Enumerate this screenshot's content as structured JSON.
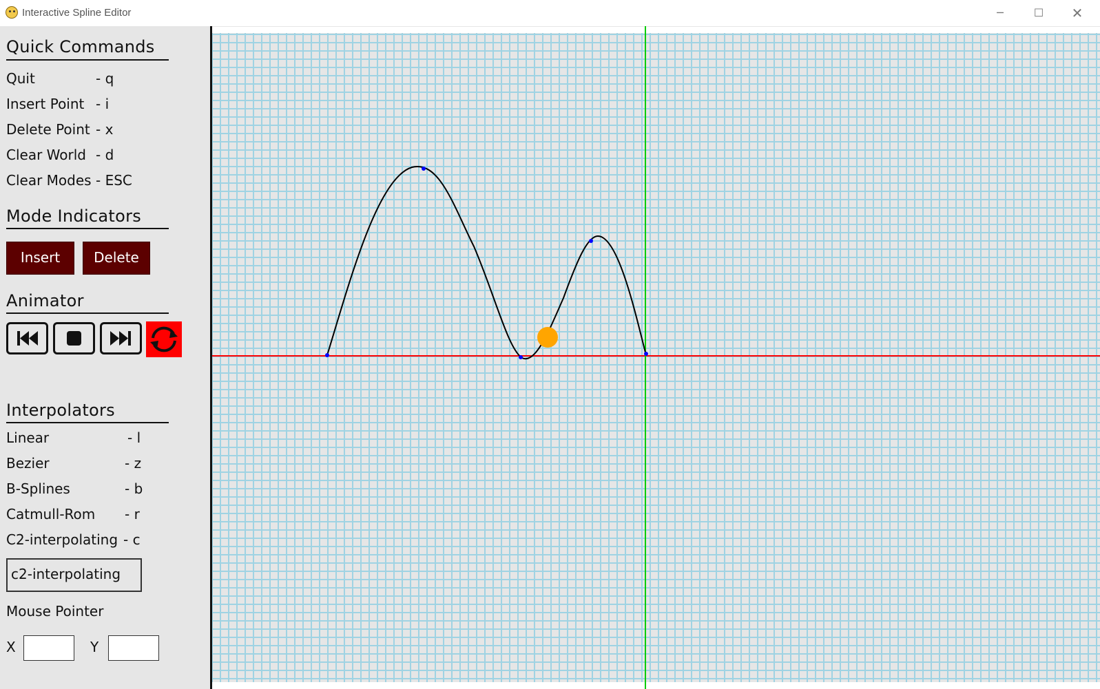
{
  "window": {
    "title": "Interactive Spline Editor",
    "controls": {
      "minimize": "─",
      "maximize": "☐",
      "close": "✕"
    }
  },
  "quick_commands": {
    "header": "Quick Commands",
    "items": [
      {
        "label": "Quit",
        "key": "-  q"
      },
      {
        "label": "Insert Point",
        "key": "-  i"
      },
      {
        "label": "Delete Point",
        "key": "-  x"
      },
      {
        "label": "Clear World",
        "key": "-  d"
      },
      {
        "label": "Clear Modes",
        "key": "-  ESC"
      }
    ]
  },
  "mode_indicators": {
    "header": "Mode Indicators",
    "insert_label": "Insert",
    "delete_label": "Delete"
  },
  "animator": {
    "header": "Animator",
    "buttons": [
      "rewind-icon",
      "stop-icon",
      "fast-forward-icon",
      "loop-icon"
    ],
    "loop_active_color": "#ff0000"
  },
  "interpolators": {
    "header": "Interpolators",
    "items": [
      {
        "label": "Linear",
        "key": "-  l"
      },
      {
        "label": "Bezier",
        "key": "-  z"
      },
      {
        "label": "B-Splines",
        "key": "-  b"
      },
      {
        "label": "Catmull-Rom",
        "key": "-  r"
      },
      {
        "label": "C2-interpolating",
        "key": "-  c"
      }
    ],
    "current": "c2-interpolating"
  },
  "mouse_pointer": {
    "header": "Mouse Pointer",
    "x_label": "X",
    "y_label": "Y",
    "x_value": "",
    "y_value": ""
  },
  "canvas": {
    "grid_color": "#9fd3e3",
    "background": "#e6e6e6",
    "x_axis_color": "#ff0000",
    "y_axis_color": "#00cc00",
    "curve_color": "#000000",
    "control_point_color": "#0000ff",
    "animated_ball_color": "#ffa500"
  }
}
